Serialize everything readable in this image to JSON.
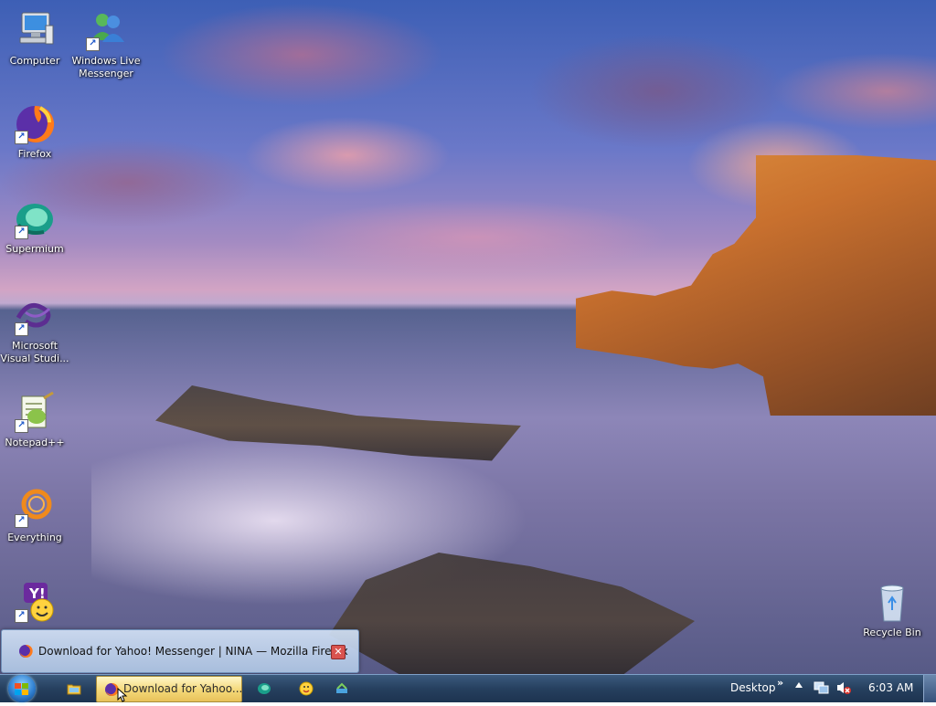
{
  "desktop": {
    "icons": [
      {
        "id": "computer",
        "label": "Computer",
        "icon": "computer-icon",
        "shortcut": false
      },
      {
        "id": "windows-live-messenger",
        "label": "Windows Live Messenger",
        "icon": "messenger-icon",
        "shortcut": true
      },
      {
        "id": "firefox",
        "label": "Firefox",
        "icon": "firefox-icon",
        "shortcut": true
      },
      {
        "id": "supermium",
        "label": "Supermium",
        "icon": "supermium-icon",
        "shortcut": true
      },
      {
        "id": "visual-studio",
        "label": "Microsoft Visual Studi...",
        "icon": "visual-studio-icon",
        "shortcut": true
      },
      {
        "id": "notepadpp",
        "label": "Notepad++",
        "icon": "notepadpp-icon",
        "shortcut": true
      },
      {
        "id": "everything",
        "label": "Everything",
        "icon": "everything-icon",
        "shortcut": true
      },
      {
        "id": "yahoo-messenger",
        "label": "",
        "icon": "yahoo-messenger-icon",
        "shortcut": true
      },
      {
        "id": "recycle-bin",
        "label": "Recycle Bin",
        "icon": "recycle-bin-icon",
        "shortcut": false
      }
    ]
  },
  "popup": {
    "title": "Download for Yahoo! Messenger | NINA — Mozilla Firefox",
    "close_symbol": "✕"
  },
  "taskbar": {
    "start_label": "Start",
    "active_task": {
      "label": "Download for Yahoo...",
      "icon": "firefox-icon"
    },
    "quick_launch": [
      {
        "id": "explorer",
        "icon": "folder-icon"
      },
      {
        "id": "supermium",
        "icon": "supermium-icon"
      },
      {
        "id": "yahoo",
        "icon": "yahoo-messenger-icon"
      },
      {
        "id": "tool",
        "icon": "tool-icon"
      }
    ],
    "toolbar_label": "Desktop",
    "toolbar_chevron": "»",
    "clock": "6:03 AM"
  },
  "colors": {
    "taskbar": "#26405f",
    "active_task": "#f4d878",
    "popup": "#c7d8ee"
  }
}
